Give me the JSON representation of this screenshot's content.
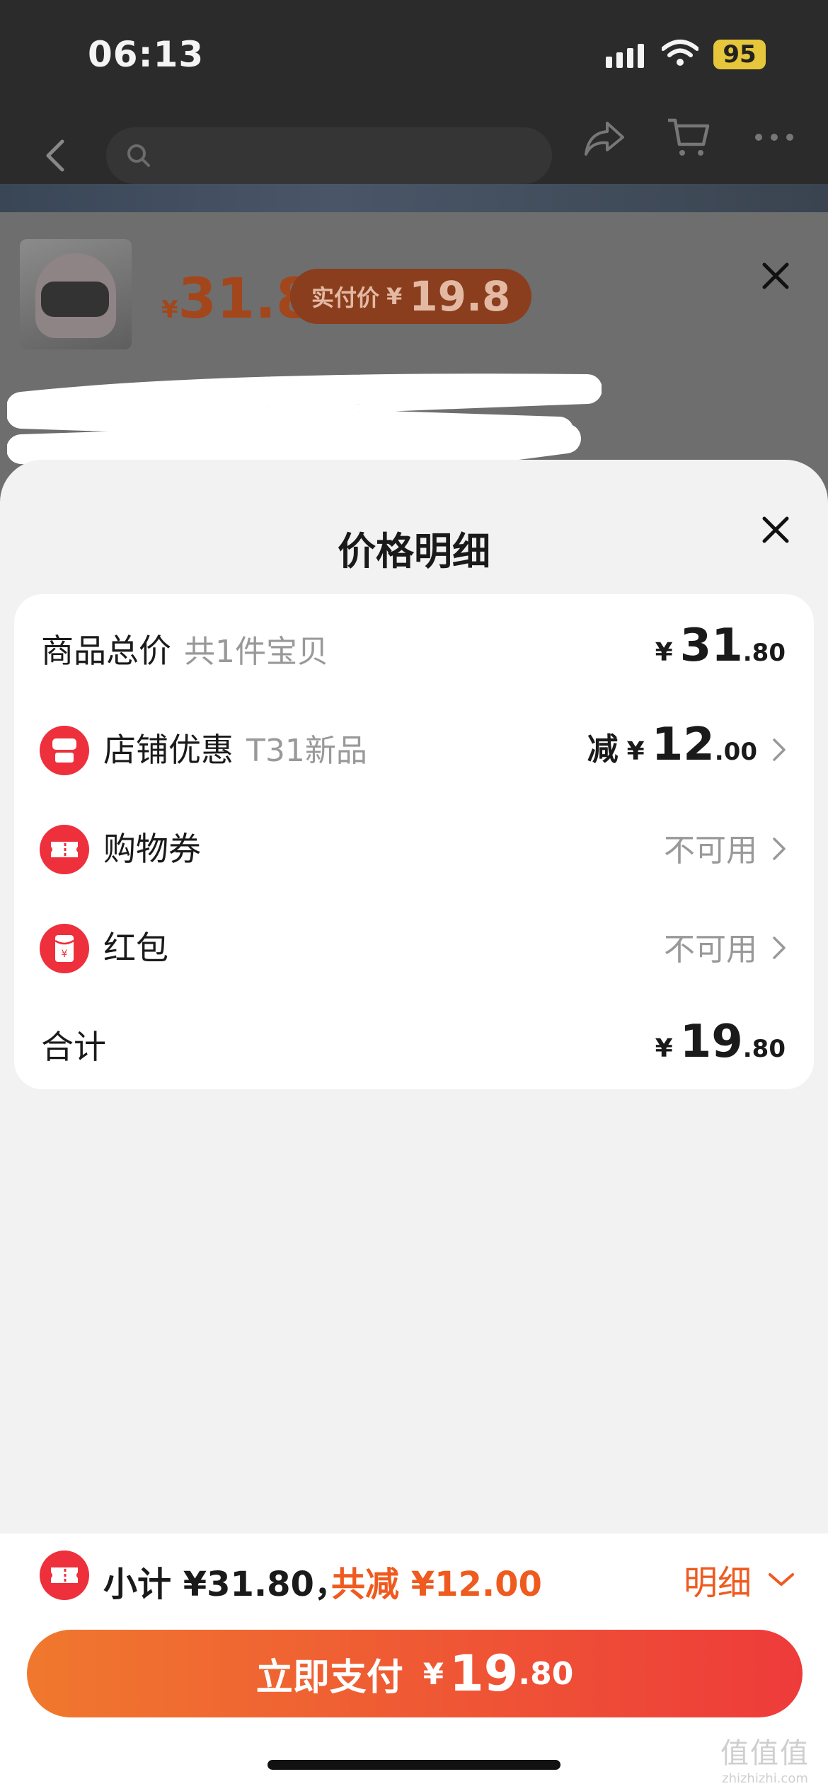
{
  "status": {
    "time": "06:13",
    "battery": "95"
  },
  "product": {
    "price_symbol": "¥",
    "price": "31.8",
    "paid_label": "实付价",
    "paid_symbol": "¥",
    "paid_value": "19.8"
  },
  "sheet": {
    "title": "价格明细",
    "rows": [
      {
        "label": "商品总价",
        "sub": "共1件宝贝",
        "yen": "¥",
        "int": "31",
        "dec": ".80"
      },
      {
        "label": "店铺优惠",
        "sub": "T31新品",
        "prefix": "减",
        "yen": "¥",
        "int": "12",
        "dec": ".00"
      },
      {
        "label": "购物券",
        "value": "不可用"
      },
      {
        "label": "红包",
        "value": "不可用"
      },
      {
        "label": "合计",
        "yen": "¥",
        "int": "19",
        "dec": ".80"
      }
    ]
  },
  "bottom": {
    "subtotal": "小计 ¥31.80，",
    "saved": "共减 ¥12.00",
    "detail": "明细",
    "pay_label": "立即支付",
    "pay_yen": "¥",
    "pay_int": "19",
    "pay_dec": ".80"
  },
  "watermark": {
    "line1": "值值值",
    "line2": "zhizhizhi.com"
  },
  "colors": {
    "accent": "#ef5a1f",
    "icon_red": "#ee2f3c"
  }
}
